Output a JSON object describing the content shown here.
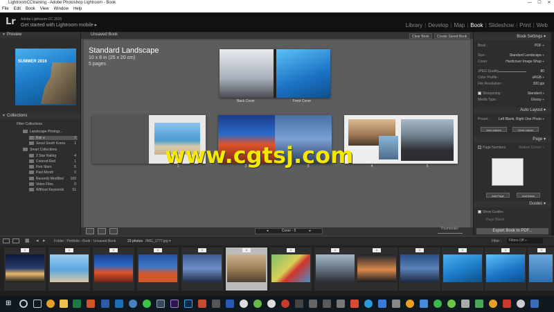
{
  "window": {
    "title": "LightroomCCtraining - Adobe Photoshop Lightroom - Book",
    "controls": [
      "—",
      "☐",
      "✕"
    ]
  },
  "menu": [
    "File",
    "Edit",
    "Book",
    "View",
    "Window",
    "Help"
  ],
  "identity": {
    "logo": "Lr",
    "product": "Adobe Lightroom CC 2015",
    "mobile": "Get started with Lightroom mobile ▸"
  },
  "modules": [
    "Library",
    "Develop",
    "Map",
    "Book",
    "Slideshow",
    "Print",
    "Web"
  ],
  "active_module": "Book",
  "left": {
    "preview_header": "Preview",
    "preview_title": "SUMMER 2016",
    "collections_header": "Collections",
    "collections": [
      {
        "label": "Filter Collections",
        "count": ""
      },
      {
        "label": "Landscape Photogr...",
        "count": ""
      },
      {
        "label": "Bali  ◂",
        "count": "2"
      },
      {
        "label": "Seoul South Korea",
        "count": "1"
      },
      {
        "label": "Smart Collections",
        "count": ""
      },
      {
        "label": "2 Star Rating",
        "count": "4"
      },
      {
        "label": "Colored Red",
        "count": "1"
      },
      {
        "label": "Five Stars",
        "count": "5"
      },
      {
        "label": "Past Month",
        "count": "0"
      },
      {
        "label": "Recently Modified",
        "count": "100"
      },
      {
        "label": "Video Files",
        "count": "0"
      },
      {
        "label": "Without Keywords",
        "count": "51"
      }
    ]
  },
  "center": {
    "book_name": "Unsaved Book",
    "clear_button": "Clear Book",
    "create_button": "Create Saved Book",
    "book_title": "Standard Landscape",
    "book_size": "10 x 8 in (25 x 20 cm)",
    "book_pages": "5 pages",
    "back_cover": "Back Cover",
    "front_cover": "Front Cover",
    "page_numbers": [
      "1",
      "2",
      "3",
      "4",
      "5"
    ],
    "pager": "Cover - 5",
    "thumbnails_label": "Thumbnails",
    "watermark": "www.cgtsj.com"
  },
  "right": {
    "book_settings_header": "Book Settings ▾",
    "book_label": "Book :",
    "book_value": "PDF ÷",
    "size_label": "Size :",
    "size_value": "Standard Landscape ÷",
    "cover_label": "Cover :",
    "cover_value": "Hardcover Image Wrap ÷",
    "jpeg_label": "JPEG Quality :",
    "jpeg_value": "80",
    "color_label": "Color Profile :",
    "color_value": "sRGB ÷",
    "res_label": "File Resolution :",
    "res_value": "300  ppi",
    "sharp_label": "Sharpening :",
    "sharp_value": "Standard ÷",
    "media_label": "Media Type :",
    "media_value": "Glossy ÷",
    "auto_layout_header": "Auto Layout ▾",
    "preset_label": "Preset :",
    "preset_value": "Left Blank, Right One Photo ÷",
    "auto_layout_btn": "Auto Layout",
    "clear_layout_btn": "Clear Layout",
    "page_header": "Page ▾",
    "page_numbers_label": "Page Numbers",
    "page_numbers_value": "Bottom Corner ÷",
    "add_page_btn": "Add Page",
    "add_blank_btn": "Add Blank",
    "guides_header": "Guides ▾",
    "show_guides": "Show Guides",
    "page_bleed": "Page Bleed",
    "export_button": "Export Book to PDF..."
  },
  "filmstrip": {
    "path": "Folder : Portfolio  ›  Book : Unsaved Book",
    "count": "23 photos",
    "filename": "/IMG_1777.jpg ▾",
    "filter_label": "Filter :",
    "filter_value": "Filters Off ÷",
    "badges": [
      "1",
      "1",
      "1",
      "1",
      "1",
      "1",
      "1",
      "1",
      "1",
      "1",
      "1",
      "1",
      "1"
    ]
  }
}
